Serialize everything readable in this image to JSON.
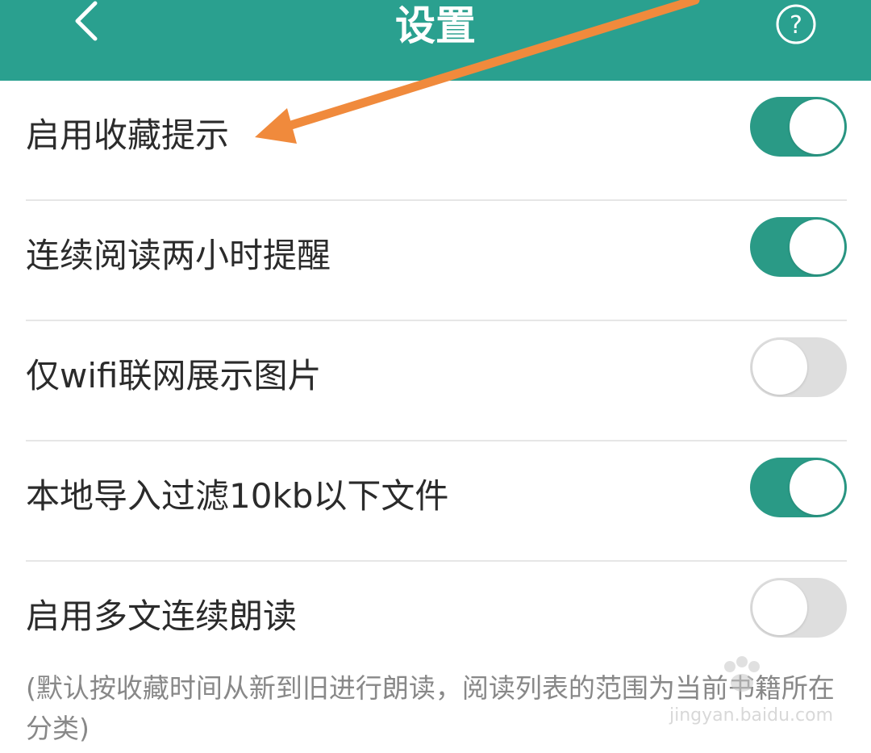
{
  "header": {
    "title": "设置",
    "back_icon": "chevron-left-icon",
    "help_icon": "help-circle-icon",
    "color": "#2aa08f"
  },
  "settings": [
    {
      "label": "启用收藏提示",
      "enabled": true
    },
    {
      "label": "连续阅读两小时提醒",
      "enabled": true
    },
    {
      "label": "仅wifi联网展示图片",
      "enabled": false
    },
    {
      "label": "本地导入过滤10kb以下文件",
      "enabled": true
    },
    {
      "label": "启用多文连续朗读",
      "enabled": false
    }
  ],
  "footnote": "(默认按收藏时间从新到旧进行朗读，阅读列表的范围为当前书籍所在分类)",
  "colors": {
    "toggle_on": "#2a9a86",
    "toggle_off": "#dedede",
    "annotation_arrow": "#f08a3c"
  },
  "watermark": {
    "text": "jingyan.baidu.com"
  }
}
